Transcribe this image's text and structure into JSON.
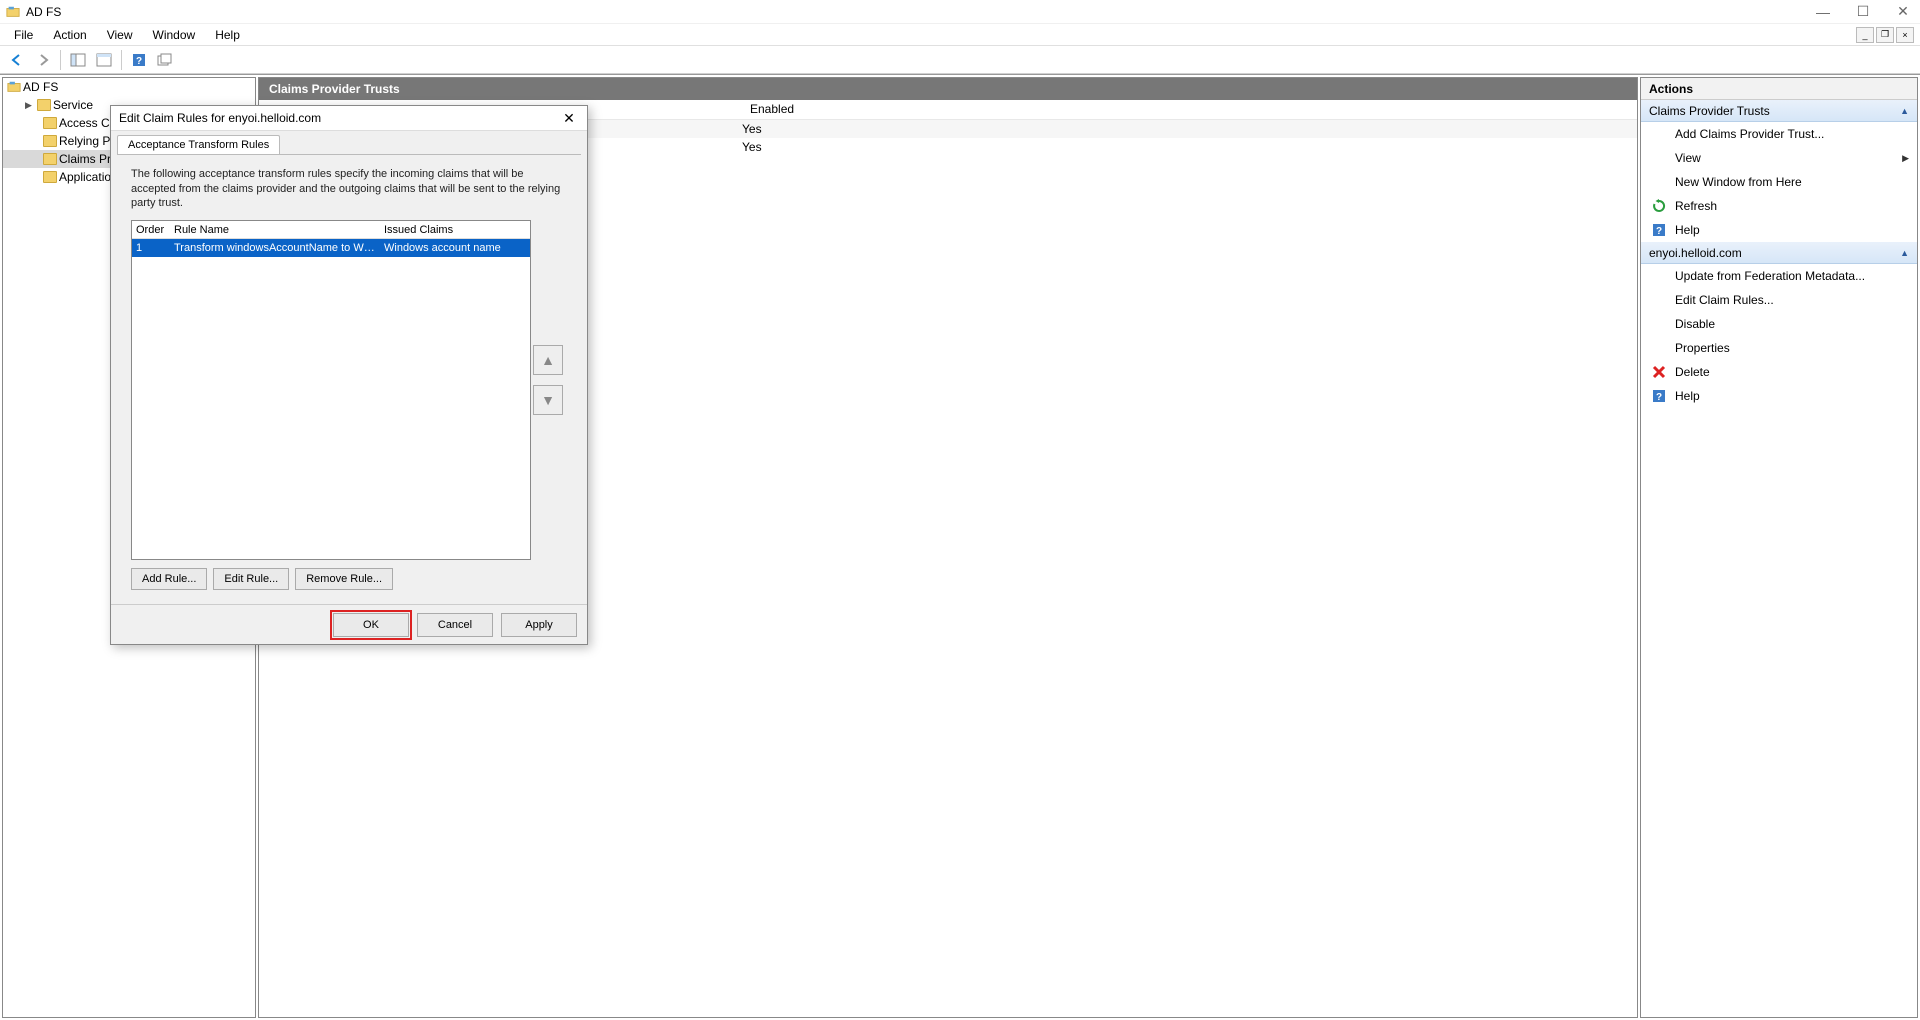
{
  "titlebar": {
    "title": "AD FS"
  },
  "menubar": {
    "file": "File",
    "action": "Action",
    "view": "View",
    "window": "Window",
    "help": "Help"
  },
  "tree": {
    "root": "AD FS",
    "items": [
      "Service",
      "Access Control Policies",
      "Relying Party Trusts",
      "Claims Provider Trusts",
      "Application Groups"
    ]
  },
  "center": {
    "header": "Claims Provider Trusts",
    "cols": {
      "name": "",
      "enabled": "Enabled"
    },
    "rows": [
      {
        "name": "",
        "enabled": "Yes"
      },
      {
        "name": "",
        "enabled": "Yes"
      }
    ]
  },
  "actions": {
    "title": "Actions",
    "section1": "Claims Provider Trusts",
    "items1": [
      {
        "label": "Add Claims Provider Trust..."
      },
      {
        "label": "View",
        "arrow": true
      },
      {
        "label": "New Window from Here"
      },
      {
        "label": "Refresh",
        "icon": "refresh"
      },
      {
        "label": "Help",
        "icon": "help"
      }
    ],
    "section2": "enyoi.helloid.com",
    "items2": [
      {
        "label": "Update from Federation Metadata..."
      },
      {
        "label": "Edit Claim Rules..."
      },
      {
        "label": "Disable"
      },
      {
        "label": "Properties"
      },
      {
        "label": "Delete",
        "icon": "delete"
      },
      {
        "label": "Help",
        "icon": "help"
      }
    ]
  },
  "dialog": {
    "title": "Edit Claim Rules for enyoi.helloid.com",
    "tab": "Acceptance Transform Rules",
    "desc": "The following acceptance transform rules specify the incoming claims that will be accepted from the claims provider and the outgoing claims that will be sent to the relying party trust.",
    "cols": {
      "order": "Order",
      "name": "Rule Name",
      "issued": "Issued Claims"
    },
    "row": {
      "order": "1",
      "name": "Transform windowsAccountName to Win...",
      "issued": "Windows account name"
    },
    "buttons": {
      "add": "Add Rule...",
      "edit": "Edit Rule...",
      "remove": "Remove Rule..."
    },
    "footer": {
      "ok": "OK",
      "cancel": "Cancel",
      "apply": "Apply"
    }
  }
}
